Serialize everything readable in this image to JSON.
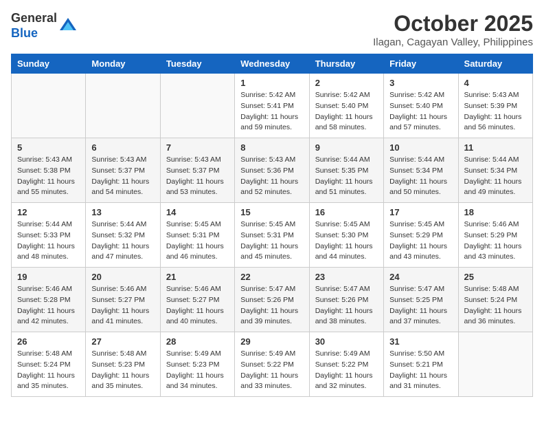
{
  "logo": {
    "general": "General",
    "blue": "Blue"
  },
  "title": "October 2025",
  "subtitle": "Ilagan, Cagayan Valley, Philippines",
  "days_of_week": [
    "Sunday",
    "Monday",
    "Tuesday",
    "Wednesday",
    "Thursday",
    "Friday",
    "Saturday"
  ],
  "weeks": [
    [
      {
        "day": "",
        "info": ""
      },
      {
        "day": "",
        "info": ""
      },
      {
        "day": "",
        "info": ""
      },
      {
        "day": "1",
        "info": "Sunrise: 5:42 AM\nSunset: 5:41 PM\nDaylight: 11 hours\nand 59 minutes."
      },
      {
        "day": "2",
        "info": "Sunrise: 5:42 AM\nSunset: 5:40 PM\nDaylight: 11 hours\nand 58 minutes."
      },
      {
        "day": "3",
        "info": "Sunrise: 5:42 AM\nSunset: 5:40 PM\nDaylight: 11 hours\nand 57 minutes."
      },
      {
        "day": "4",
        "info": "Sunrise: 5:43 AM\nSunset: 5:39 PM\nDaylight: 11 hours\nand 56 minutes."
      }
    ],
    [
      {
        "day": "5",
        "info": "Sunrise: 5:43 AM\nSunset: 5:38 PM\nDaylight: 11 hours\nand 55 minutes."
      },
      {
        "day": "6",
        "info": "Sunrise: 5:43 AM\nSunset: 5:37 PM\nDaylight: 11 hours\nand 54 minutes."
      },
      {
        "day": "7",
        "info": "Sunrise: 5:43 AM\nSunset: 5:37 PM\nDaylight: 11 hours\nand 53 minutes."
      },
      {
        "day": "8",
        "info": "Sunrise: 5:43 AM\nSunset: 5:36 PM\nDaylight: 11 hours\nand 52 minutes."
      },
      {
        "day": "9",
        "info": "Sunrise: 5:44 AM\nSunset: 5:35 PM\nDaylight: 11 hours\nand 51 minutes."
      },
      {
        "day": "10",
        "info": "Sunrise: 5:44 AM\nSunset: 5:34 PM\nDaylight: 11 hours\nand 50 minutes."
      },
      {
        "day": "11",
        "info": "Sunrise: 5:44 AM\nSunset: 5:34 PM\nDaylight: 11 hours\nand 49 minutes."
      }
    ],
    [
      {
        "day": "12",
        "info": "Sunrise: 5:44 AM\nSunset: 5:33 PM\nDaylight: 11 hours\nand 48 minutes."
      },
      {
        "day": "13",
        "info": "Sunrise: 5:44 AM\nSunset: 5:32 PM\nDaylight: 11 hours\nand 47 minutes."
      },
      {
        "day": "14",
        "info": "Sunrise: 5:45 AM\nSunset: 5:31 PM\nDaylight: 11 hours\nand 46 minutes."
      },
      {
        "day": "15",
        "info": "Sunrise: 5:45 AM\nSunset: 5:31 PM\nDaylight: 11 hours\nand 45 minutes."
      },
      {
        "day": "16",
        "info": "Sunrise: 5:45 AM\nSunset: 5:30 PM\nDaylight: 11 hours\nand 44 minutes."
      },
      {
        "day": "17",
        "info": "Sunrise: 5:45 AM\nSunset: 5:29 PM\nDaylight: 11 hours\nand 43 minutes."
      },
      {
        "day": "18",
        "info": "Sunrise: 5:46 AM\nSunset: 5:29 PM\nDaylight: 11 hours\nand 43 minutes."
      }
    ],
    [
      {
        "day": "19",
        "info": "Sunrise: 5:46 AM\nSunset: 5:28 PM\nDaylight: 11 hours\nand 42 minutes."
      },
      {
        "day": "20",
        "info": "Sunrise: 5:46 AM\nSunset: 5:27 PM\nDaylight: 11 hours\nand 41 minutes."
      },
      {
        "day": "21",
        "info": "Sunrise: 5:46 AM\nSunset: 5:27 PM\nDaylight: 11 hours\nand 40 minutes."
      },
      {
        "day": "22",
        "info": "Sunrise: 5:47 AM\nSunset: 5:26 PM\nDaylight: 11 hours\nand 39 minutes."
      },
      {
        "day": "23",
        "info": "Sunrise: 5:47 AM\nSunset: 5:26 PM\nDaylight: 11 hours\nand 38 minutes."
      },
      {
        "day": "24",
        "info": "Sunrise: 5:47 AM\nSunset: 5:25 PM\nDaylight: 11 hours\nand 37 minutes."
      },
      {
        "day": "25",
        "info": "Sunrise: 5:48 AM\nSunset: 5:24 PM\nDaylight: 11 hours\nand 36 minutes."
      }
    ],
    [
      {
        "day": "26",
        "info": "Sunrise: 5:48 AM\nSunset: 5:24 PM\nDaylight: 11 hours\nand 35 minutes."
      },
      {
        "day": "27",
        "info": "Sunrise: 5:48 AM\nSunset: 5:23 PM\nDaylight: 11 hours\nand 35 minutes."
      },
      {
        "day": "28",
        "info": "Sunrise: 5:49 AM\nSunset: 5:23 PM\nDaylight: 11 hours\nand 34 minutes."
      },
      {
        "day": "29",
        "info": "Sunrise: 5:49 AM\nSunset: 5:22 PM\nDaylight: 11 hours\nand 33 minutes."
      },
      {
        "day": "30",
        "info": "Sunrise: 5:49 AM\nSunset: 5:22 PM\nDaylight: 11 hours\nand 32 minutes."
      },
      {
        "day": "31",
        "info": "Sunrise: 5:50 AM\nSunset: 5:21 PM\nDaylight: 11 hours\nand 31 minutes."
      },
      {
        "day": "",
        "info": ""
      }
    ]
  ]
}
